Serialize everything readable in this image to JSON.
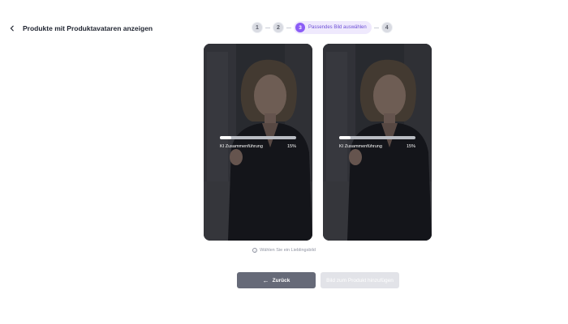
{
  "header": {
    "back_icon": "chevron-left-icon",
    "title": "Produkte mit Produktavataren anzeigen"
  },
  "stepper": {
    "steps": [
      {
        "number": "1"
      },
      {
        "number": "2"
      },
      {
        "number": "3",
        "label": "Passendes Bild auswählen",
        "active": true
      },
      {
        "number": "4"
      }
    ],
    "accent_color": "#8b5cf6"
  },
  "cards": [
    {
      "progress_label": "KI Zusammenführung",
      "progress_percent": "15%",
      "progress_value": 15
    },
    {
      "progress_label": "KI Zusammenführung",
      "progress_percent": "15%",
      "progress_value": 15
    }
  ],
  "hint": {
    "icon": "info-icon",
    "text": "Wählen Sie ein Lieblingsbild"
  },
  "buttons": {
    "back_label": "Zurück",
    "back_icon": "arrow-left-icon",
    "next_label": "Bild zum Produkt hinzufügen"
  }
}
